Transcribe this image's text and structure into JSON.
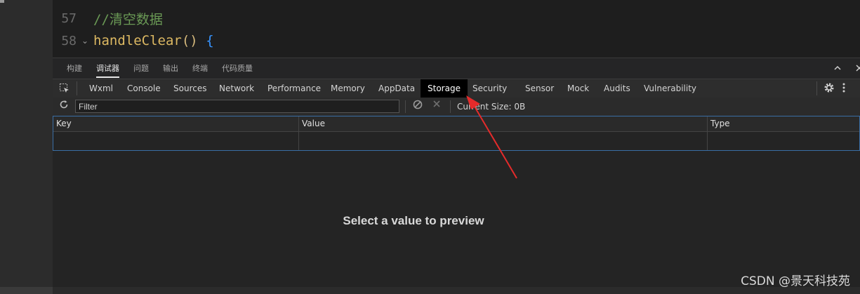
{
  "editor": {
    "lines": [
      {
        "number": "57",
        "text": "//清空数据"
      },
      {
        "number": "58",
        "fn": "handleClear",
        "paren": "()",
        "brace": "{"
      }
    ]
  },
  "panel_tabs": [
    "构建",
    "调试器",
    "问题",
    "输出",
    "终端",
    "代码质量"
  ],
  "panel_active_tab": "调试器",
  "panel_icons": [
    "chevron-up-icon",
    "close-icon"
  ],
  "devtools_tabs": [
    "Wxml",
    "Console",
    "Sources",
    "Network",
    "Performance",
    "Memory",
    "AppData",
    "Storage",
    "Security",
    "Sensor",
    "Mock",
    "Audits",
    "Vulnerability"
  ],
  "active_devtools_tab": "Storage",
  "filter": {
    "placeholder": "Filter"
  },
  "current_size": "Current Size: 0B",
  "table": {
    "columns": [
      "Key",
      "Value",
      "Type"
    ]
  },
  "preview": {
    "message": "Select a value to preview"
  },
  "watermark": "CSDN @景天科技苑",
  "colors": {
    "arrow": "#e52b2b",
    "comment": "#6a9955",
    "function": "#dcb862",
    "brace": "#3794ff",
    "grid_border": "#3a6ea5"
  }
}
